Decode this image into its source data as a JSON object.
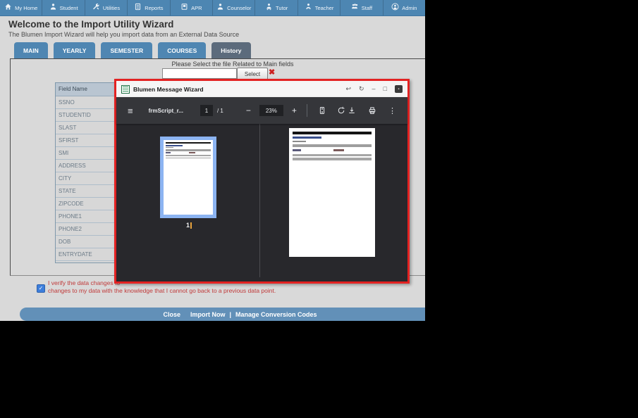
{
  "navbar": {
    "items": [
      {
        "label": "My Home",
        "icon": "home-icon"
      },
      {
        "label": "Student",
        "icon": "person-icon"
      },
      {
        "label": "Utilities",
        "icon": "wrench-icon"
      },
      {
        "label": "Reports",
        "icon": "report-icon"
      },
      {
        "label": "APR",
        "icon": "apr-book-icon"
      },
      {
        "label": "Counselor",
        "icon": "person-icon"
      },
      {
        "label": "Tutor",
        "icon": "person-desk-icon"
      },
      {
        "label": "Teacher",
        "icon": "person-board-icon"
      },
      {
        "label": "Staff",
        "icon": "people-icon"
      },
      {
        "label": "Admin",
        "icon": "person-circle-icon"
      }
    ]
  },
  "header": {
    "title": "Welcome to the Import Utility Wizard",
    "subtitle": "The Blumen Import Wizard will help you import data from an External Data Source"
  },
  "tabs": [
    {
      "label": "MAIN",
      "active": false
    },
    {
      "label": "YEARLY",
      "active": false
    },
    {
      "label": "SEMESTER",
      "active": false
    },
    {
      "label": "COURSES",
      "active": false
    },
    {
      "label": "History",
      "active": true
    }
  ],
  "file_select": {
    "prompt": "Please Select the file Related to Main fields",
    "input_value": "",
    "button_label": "Select",
    "clear_glyph": "✖"
  },
  "field_table": {
    "header": "Field Name",
    "rows": [
      "SSNO",
      "STUDENTID",
      "SLAST",
      "SFIRST",
      "SMI",
      "ADDRESS",
      "CITY",
      "STATE",
      "ZIPCODE",
      "PHONE1",
      "PHONE2",
      "DOB",
      "ENTRYDATE"
    ]
  },
  "verify": {
    "checked": true,
    "check_glyph": "✓",
    "line1": "I verify the data changes to",
    "line2": "changes to my data with the knowledge that I cannot go back to a previous data point."
  },
  "footer": {
    "close": "Close",
    "import_now": "Import Now",
    "separator": "|",
    "manage": "Manage Conversion Codes"
  },
  "modal": {
    "title": "Blumen Message Wizard",
    "window_controls": [
      {
        "name": "popout-icon",
        "glyph": "↩"
      },
      {
        "name": "refresh-icon",
        "glyph": "↻"
      },
      {
        "name": "minimize-icon",
        "glyph": "–"
      },
      {
        "name": "maximize-icon",
        "glyph": "□"
      },
      {
        "name": "close-icon",
        "glyph": "▪"
      }
    ],
    "pdf_toolbar": {
      "doc_title": "frmScript_r...",
      "page_current": "1",
      "page_total": "/ 1",
      "zoom_out_glyph": "−",
      "zoom_level": "23%",
      "zoom_in_glyph": "+",
      "kebab_glyph": "⋮",
      "hamburger_glyph": "≡"
    },
    "thumbnail_page_number": "1"
  },
  "colors": {
    "nav_blue": "#4d86b2",
    "tab_blue": "#4f86b2",
    "tab_active": "#5c6b7c",
    "page_bg": "#d9d9d9",
    "footer_blue": "#6290b8",
    "modal_border_red": "#e32222",
    "pdf_toolbar_bg": "#35363a",
    "pdf_content_bg": "#28282c",
    "thumb_select_blue": "#8cb4f2",
    "verify_red": "#c03a3a",
    "checkbox_blue": "#3d7edb"
  }
}
